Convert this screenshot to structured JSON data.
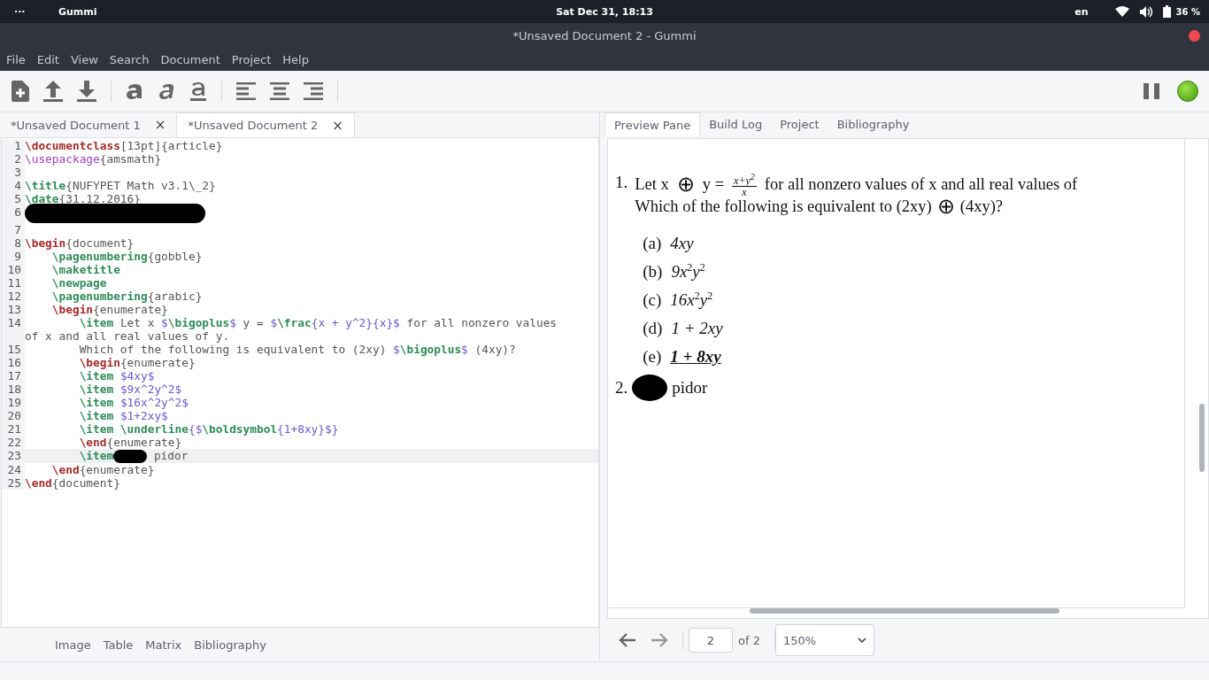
{
  "top_bar": {
    "menu_dots": "···",
    "app_name": "Gummi",
    "clock": "Sat Dec 31, 18:13",
    "language": "en",
    "battery": "36 %"
  },
  "window": {
    "title": "*Unsaved Document 2 - Gummi"
  },
  "menu": [
    "File",
    "Edit",
    "View",
    "Search",
    "Document",
    "Project",
    "Help"
  ],
  "editor_tabs": [
    {
      "label": "*Unsaved Document 1",
      "close": "×",
      "selected": false
    },
    {
      "label": "*Unsaved Document 2",
      "close": "×",
      "selected": true
    }
  ],
  "code_lines": [
    {
      "number": "1",
      "highlighted": false,
      "tokens": [
        {
          "kind": "keyword",
          "text": "\\documentclass"
        },
        {
          "kind": "text",
          "text": "[13pt]{article}"
        }
      ]
    },
    {
      "number": "2",
      "highlighted": false,
      "tokens": [
        {
          "kind": "package",
          "text": "\\usepackage"
        },
        {
          "kind": "text",
          "text": "{amsmath}"
        }
      ]
    },
    {
      "number": "3",
      "highlighted": false
    },
    {
      "number": "4",
      "highlighted": false,
      "tokens": [
        {
          "kind": "command",
          "text": "\\title"
        },
        {
          "kind": "text",
          "text": "{NUFYPET Math v3.1\\_2}"
        }
      ]
    },
    {
      "number": "5",
      "highlighted": false,
      "tokens": [
        {
          "kind": "command",
          "text": "\\date"
        },
        {
          "kind": "text",
          "text": "{31.12.2016}"
        }
      ]
    },
    {
      "number": "6",
      "highlighted": false,
      "tokens": [
        {
          "kind": "redaction"
        }
      ]
    },
    {
      "number": "7",
      "highlighted": false
    },
    {
      "number": "8",
      "highlighted": false,
      "tokens": [
        {
          "kind": "keyword",
          "text": "\\begin"
        },
        {
          "kind": "text",
          "text": "{document}"
        }
      ]
    },
    {
      "number": "9",
      "highlighted": false,
      "tokens": [
        {
          "kind": "command",
          "text": "    \\pagenumbering"
        },
        {
          "kind": "text",
          "text": "{gobble}"
        }
      ]
    },
    {
      "number": "10",
      "highlighted": false,
      "tokens": [
        {
          "kind": "command",
          "text": "    \\maketitle"
        }
      ]
    },
    {
      "number": "11",
      "highlighted": false,
      "tokens": [
        {
          "kind": "command",
          "text": "    \\newpage"
        }
      ]
    },
    {
      "number": "12",
      "highlighted": false,
      "tokens": [
        {
          "kind": "command",
          "text": "    \\pagenumbering"
        },
        {
          "kind": "text",
          "text": "{arabic}"
        }
      ]
    },
    {
      "number": "13",
      "highlighted": false,
      "tokens": [
        {
          "kind": "keyword",
          "text": "    \\begin"
        },
        {
          "kind": "text",
          "text": "{enumerate}"
        }
      ]
    },
    {
      "number": "14",
      "highlighted": false,
      "tokens": [
        {
          "kind": "command",
          "text": "        \\item"
        },
        {
          "kind": "text",
          "text": " Let x "
        },
        {
          "kind": "math",
          "text": "$"
        },
        {
          "kind": "command",
          "text": "\\bigoplus"
        },
        {
          "kind": "math",
          "text": "$"
        },
        {
          "kind": "text",
          "text": " y = "
        },
        {
          "kind": "math",
          "text": "$"
        },
        {
          "kind": "command",
          "text": "\\frac"
        },
        {
          "kind": "math",
          "text": "{x + y^2}{x}$"
        },
        {
          "kind": "text",
          "text": " for all nonzero values of x and all real values of y."
        }
      ]
    },
    {
      "number": "15",
      "highlighted": false,
      "tokens": [
        {
          "kind": "text",
          "text": "        Which of the following is equivalent to (2xy) "
        },
        {
          "kind": "math",
          "text": "$"
        },
        {
          "kind": "command",
          "text": "\\bigoplus"
        },
        {
          "kind": "math",
          "text": "$"
        },
        {
          "kind": "text",
          "text": " (4xy)?"
        }
      ]
    },
    {
      "number": "16",
      "highlighted": false,
      "tokens": [
        {
          "kind": "keyword",
          "text": "        \\begin"
        },
        {
          "kind": "text",
          "text": "{enumerate}"
        }
      ]
    },
    {
      "number": "17",
      "highlighted": false,
      "tokens": [
        {
          "kind": "command",
          "text": "        \\item"
        },
        {
          "kind": "math",
          "text": " $4xy$"
        }
      ]
    },
    {
      "number": "18",
      "highlighted": false,
      "tokens": [
        {
          "kind": "command",
          "text": "        \\item"
        },
        {
          "kind": "math",
          "text": " $9x^2y^2$"
        }
      ]
    },
    {
      "number": "19",
      "highlighted": false,
      "tokens": [
        {
          "kind": "command",
          "text": "        \\item"
        },
        {
          "kind": "math",
          "text": " $16x^2y^2$"
        }
      ]
    },
    {
      "number": "20",
      "highlighted": false,
      "tokens": [
        {
          "kind": "command",
          "text": "        \\item"
        },
        {
          "kind": "math",
          "text": " $1+2xy$"
        }
      ]
    },
    {
      "number": "21",
      "highlighted": false,
      "tokens": [
        {
          "kind": "command",
          "text": "        \\item \\underline"
        },
        {
          "kind": "math",
          "text": "{$"
        },
        {
          "kind": "command",
          "text": "\\boldsymbol"
        },
        {
          "kind": "math",
          "text": "{1+8xy}$}"
        }
      ]
    },
    {
      "number": "22",
      "highlighted": false,
      "tokens": [
        {
          "kind": "keyword",
          "text": "        \\end"
        },
        {
          "kind": "text",
          "text": "{enumerate}"
        }
      ]
    },
    {
      "number": "23",
      "highlighted": true,
      "tokens": [
        {
          "kind": "command",
          "text": "        \\item"
        },
        {
          "kind": "redaction"
        },
        {
          "kind": "text",
          "text": " pidor"
        }
      ]
    },
    {
      "number": "24",
      "highlighted": false,
      "tokens": [
        {
          "kind": "keyword",
          "text": "    \\end"
        },
        {
          "kind": "text",
          "text": "{enumerate}"
        }
      ]
    },
    {
      "number": "25",
      "highlighted": false,
      "tokens": [
        {
          "kind": "keyword",
          "text": "\\end"
        },
        {
          "kind": "text",
          "text": "{document}"
        }
      ]
    }
  ],
  "insert_links": [
    "Image",
    "Table",
    "Matrix",
    "Bibliography"
  ],
  "preview_tabs": [
    {
      "label": "Preview Pane",
      "selected": true
    },
    {
      "label": "Build Log",
      "selected": false
    },
    {
      "label": "Project",
      "selected": false
    },
    {
      "label": "Bibliography",
      "selected": false
    }
  ],
  "preview": {
    "items": [
      {
        "marker": "1.",
        "kind": "question",
        "before": "Let x",
        "oplus": "⊕",
        "middle": "y =",
        "numerator": "x+y$^{2}$",
        "denominator": "x",
        "after": "for all nonzero values of x and all real values of",
        "line2_before": "Which of the following is equivalent to (2xy)",
        "line2_oplus": "⊕",
        "line2_after": "(4xy)?",
        "choices": [
          {
            "marker": "(a)",
            "text": "4xy",
            "emphasis": false
          },
          {
            "marker": "(b)",
            "text": "9x$^{2}$y$^{2}$",
            "emphasis": false
          },
          {
            "marker": "(c)",
            "text": "16x$^{2}$y$^{2}$",
            "emphasis": false
          },
          {
            "marker": "(d)",
            "text": "1 + 2xy",
            "emphasis": false
          },
          {
            "marker": "(e)",
            "text": "1 + 8xy",
            "emphasis": true
          }
        ]
      },
      {
        "marker": "2.",
        "kind": "redacted",
        "text": "pidor"
      }
    ]
  },
  "pager": {
    "page": "2",
    "of": "of 2",
    "zoom": "150%"
  }
}
